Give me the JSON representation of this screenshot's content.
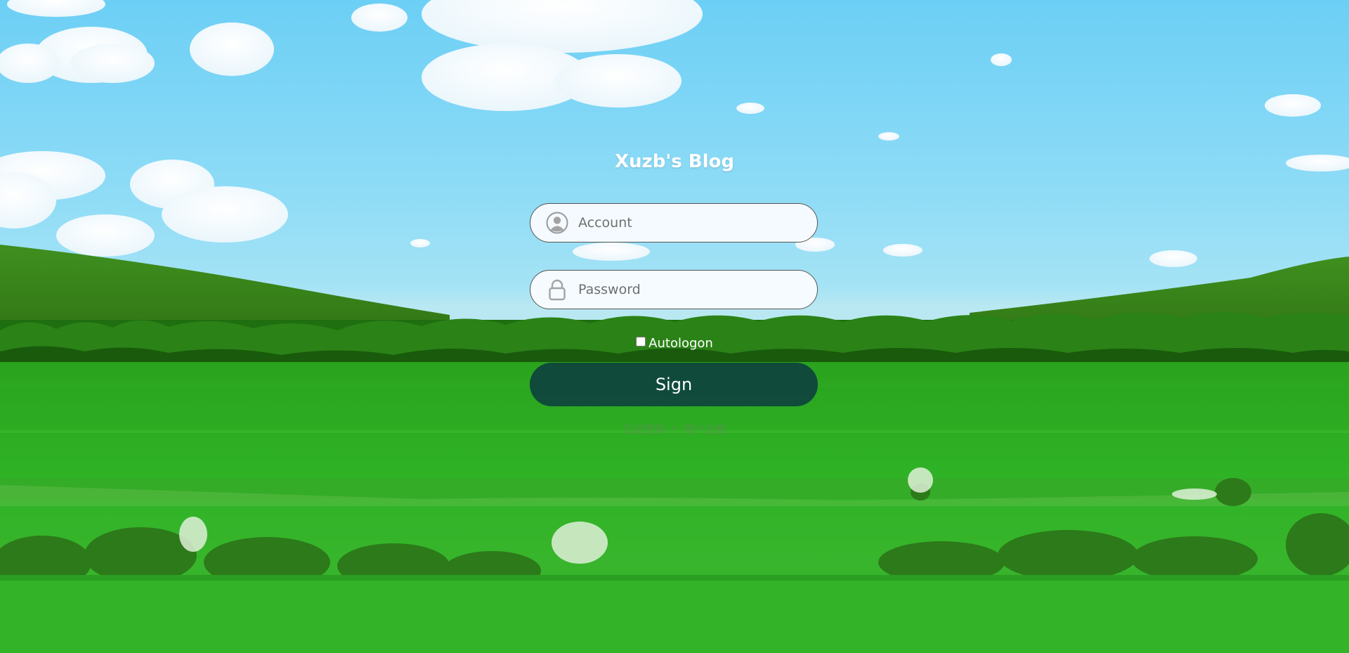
{
  "page": {
    "title": "Xuzb's Blog"
  },
  "form": {
    "account_placeholder": "Account",
    "account_icon": "user-icon",
    "password_placeholder": "Password",
    "password_icon": "lock-icon",
    "autologon_label": "Autologon",
    "autologon_checked": false,
    "sign_label": "Sign"
  },
  "footer": {
    "links": [
      "忘记密码",
      "用户注册"
    ],
    "separator": "•"
  },
  "colors": {
    "sky": "#7fd6f6",
    "grass": "#25a81c",
    "button": "#0c3e40",
    "text": "#ffffff"
  }
}
